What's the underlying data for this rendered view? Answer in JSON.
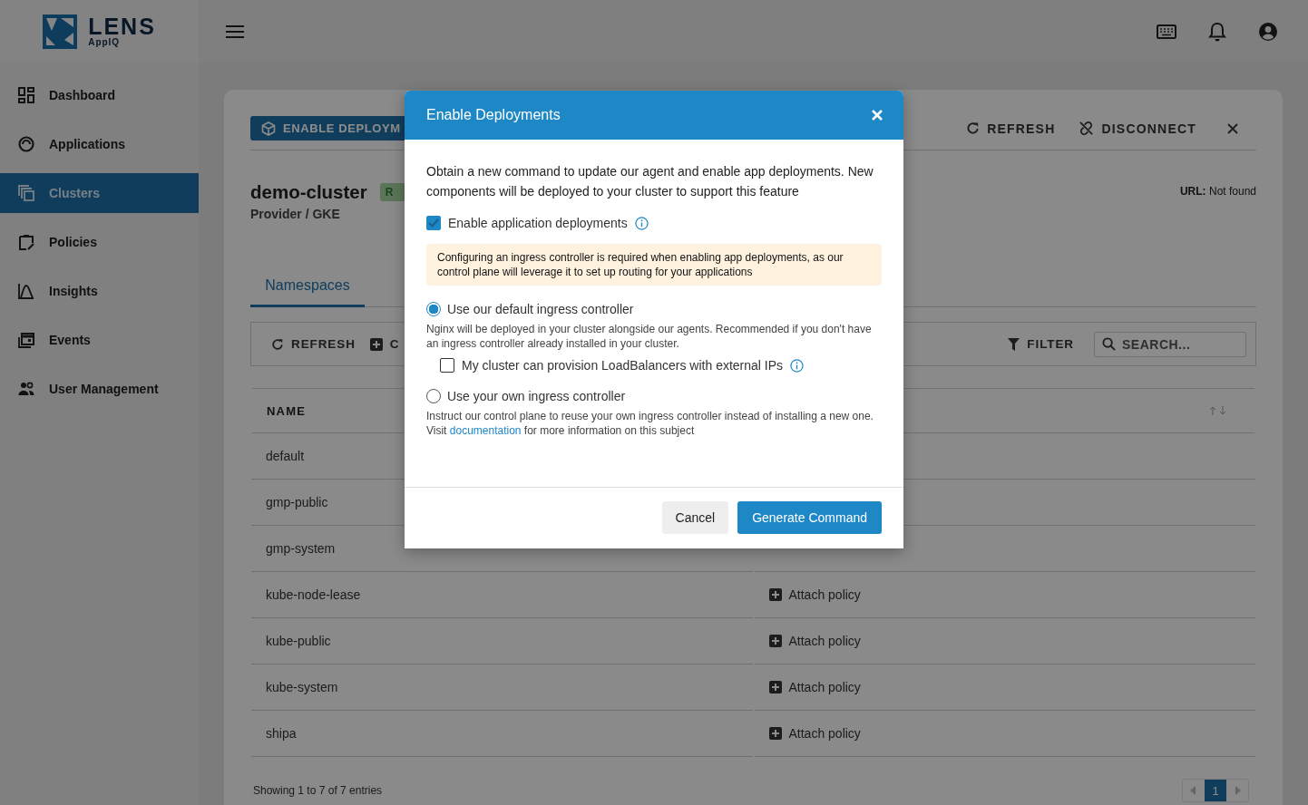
{
  "app": {
    "logo_text": "LENS",
    "logo_subtext": "AppIQ"
  },
  "sidebar": {
    "items": [
      {
        "label": "Dashboard",
        "selected": false
      },
      {
        "label": "Applications",
        "selected": false
      },
      {
        "label": "Clusters",
        "selected": true
      },
      {
        "label": "Policies",
        "selected": false
      },
      {
        "label": "Insights",
        "selected": false
      },
      {
        "label": "Events",
        "selected": false
      },
      {
        "label": "User Management",
        "selected": false
      }
    ]
  },
  "cluster": {
    "enable_button": "ENABLE DEPLOYM",
    "refresh": "REFRESH",
    "disconnect": "DISCONNECT",
    "name": "demo-cluster",
    "status_badge": "R",
    "provider": "Provider / GKE",
    "url": "**URL:** Not found"
  },
  "tabs": [
    {
      "label": "Namespaces",
      "selected": true
    }
  ],
  "toolbar": {
    "refresh": "REFRESH",
    "create": "C",
    "filter": "FILTER",
    "search_placeholder": "SEARCH..."
  },
  "table": {
    "columns": [
      "NAME"
    ],
    "rows": [
      {
        "name": "default"
      },
      {
        "name": "gmp-public"
      },
      {
        "name": "gmp-system"
      },
      {
        "name": "kube-node-lease",
        "action": "Attach policy"
      },
      {
        "name": "kube-public",
        "action": "Attach policy"
      },
      {
        "name": "kube-system",
        "action": "Attach policy"
      },
      {
        "name": "shipa",
        "action": "Attach policy"
      }
    ]
  },
  "footer": {
    "entries": "Showing 1 to 7 of 7 entries",
    "pages": [
      {
        "label": "1",
        "selected": true
      }
    ]
  },
  "dialog": {
    "title": "Enable Deployments",
    "description": "Obtain a new command to update our agent and enable app deployments. New components will be deployed to your cluster to support this feature",
    "enable_checkbox": {
      "label": "Enable application deployments",
      "checked": true
    },
    "note": "Configuring an ingress controller is required when enabling app deployments, as our control plane will leverage it to set up routing for your applications",
    "options": [
      {
        "label": "Use our default ingress controller",
        "selected": true,
        "description": "Nginx will be deployed in your cluster alongside our agents. Recommended if you don't have an ingress controller already installed in your cluster.",
        "checkbox": {
          "label": "My cluster can provision LoadBalancers with external IPs",
          "checked": false
        }
      },
      {
        "label": "Use your own ingress controller",
        "selected": false,
        "description": "Instruct our control plane to reuse your own ingress controller instead of installing a new one. Visit",
        "link": "documentation",
        "description_after": "for more information on this subject"
      }
    ],
    "cancel": "Cancel",
    "confirm": "Generate Command"
  }
}
